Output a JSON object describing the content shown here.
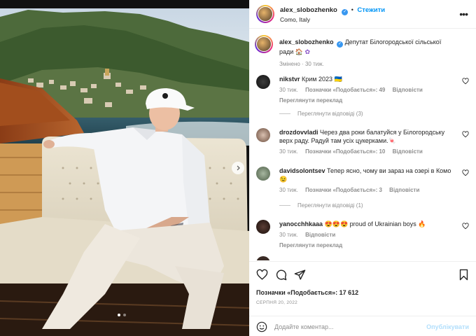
{
  "post": {
    "author": "alex_slobozhenko",
    "follow_label": "Стежити",
    "location": "Como, Italy",
    "caption": "Депутат Білогородської сільської ради",
    "caption_meta": "Змінено · 30 тиж.",
    "more_label": "•••"
  },
  "comments": [
    {
      "user": "nikstvr",
      "text": "Крим 2023 🇺🇦",
      "time": "30 тиж.",
      "likes": "Позначки «Подобається»: 49",
      "reply": "Відповісти",
      "extra": "Переглянути переклад",
      "view_replies": "Переглянути відповіді (3)"
    },
    {
      "user": "drozdovvladi",
      "text": "Через два роки балатуйся у Білогородську верх раду. Радуй там усіх цукерками.🍬",
      "time": "30 тиж.",
      "likes": "Позначки «Подобається»: 10",
      "reply": "Відповісти"
    },
    {
      "user": "davidsolontsev",
      "text": "Тепер ясно, чому ви зараз на озері в Комо 😉",
      "time": "30 тиж.",
      "likes": "Позначки «Подобається»: 3",
      "reply": "Відповісти",
      "view_replies": "Переглянути відповіді (1)"
    },
    {
      "user": "yanocchhkaaa",
      "text": "😍😍😍 proud of Ukrainian boys 🔥",
      "time": "30 тиж.",
      "reply": "Відповісти",
      "extra": "Переглянути переклад"
    }
  ],
  "footer": {
    "likes": "Позначки «Подобається»: 17 612",
    "date": "СЕРПНЯ 20, 2022",
    "comment_placeholder": "Додайте коментар...",
    "post_label": "Опублікувати"
  },
  "colors": {
    "accent": "#0095f6",
    "muted": "#8e8e8e",
    "text": "#262626"
  }
}
